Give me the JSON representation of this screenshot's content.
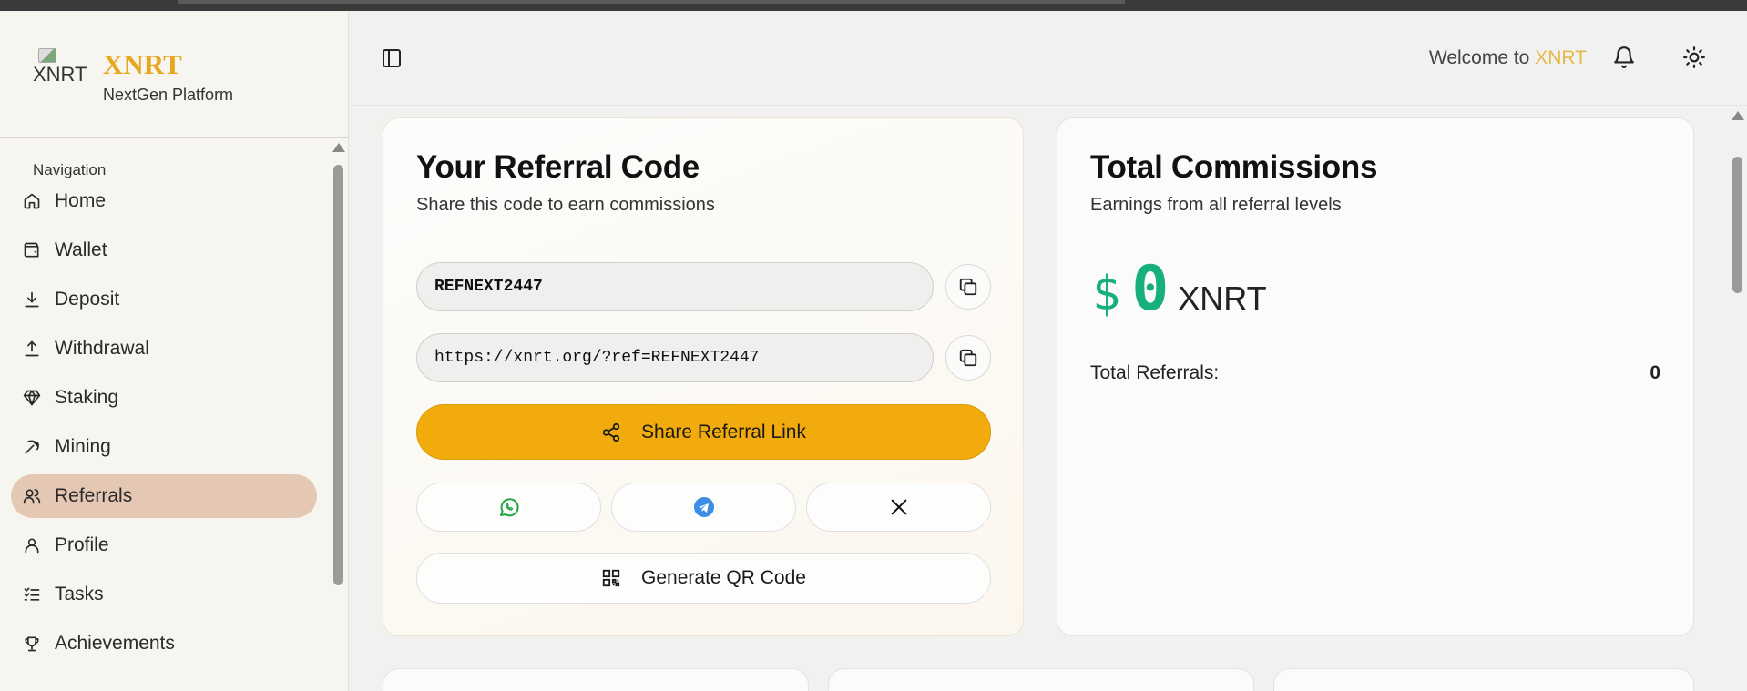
{
  "brand": {
    "logo_alt": "XNRT",
    "name": "XNRT",
    "tagline": "NextGen Platform"
  },
  "sidebar": {
    "heading": "Navigation",
    "items": [
      {
        "label": "Home",
        "icon": "home-icon"
      },
      {
        "label": "Wallet",
        "icon": "wallet-icon"
      },
      {
        "label": "Deposit",
        "icon": "download-icon"
      },
      {
        "label": "Withdrawal",
        "icon": "upload-icon"
      },
      {
        "label": "Staking",
        "icon": "gem-icon"
      },
      {
        "label": "Mining",
        "icon": "pickaxe-icon"
      },
      {
        "label": "Referrals",
        "icon": "users-icon",
        "active": true
      },
      {
        "label": "Profile",
        "icon": "user-icon"
      },
      {
        "label": "Tasks",
        "icon": "list-checks-icon"
      },
      {
        "label": "Achievements",
        "icon": "trophy-icon"
      }
    ]
  },
  "header": {
    "welcome_prefix": "Welcome to ",
    "welcome_brand": "XNRT"
  },
  "referral_card": {
    "title": "Your Referral Code",
    "subtitle": "Share this code to earn commissions",
    "code": "REFNEXT2447",
    "link": "https://xnrt.org/?ref=REFNEXT2447",
    "share_label": "Share Referral Link",
    "qr_label": "Generate QR Code"
  },
  "commissions_card": {
    "title": "Total Commissions",
    "subtitle": "Earnings from all referral levels",
    "currency_symbol": "$",
    "amount": "0",
    "unit": "XNRT",
    "referrals_label": "Total Referrals:",
    "referrals_count": "0"
  },
  "colors": {
    "accent": "#f1ab0c",
    "active_nav": "#e5c8b4",
    "amount_green": "#17b07a",
    "brand_gold": "#e6a81f"
  }
}
